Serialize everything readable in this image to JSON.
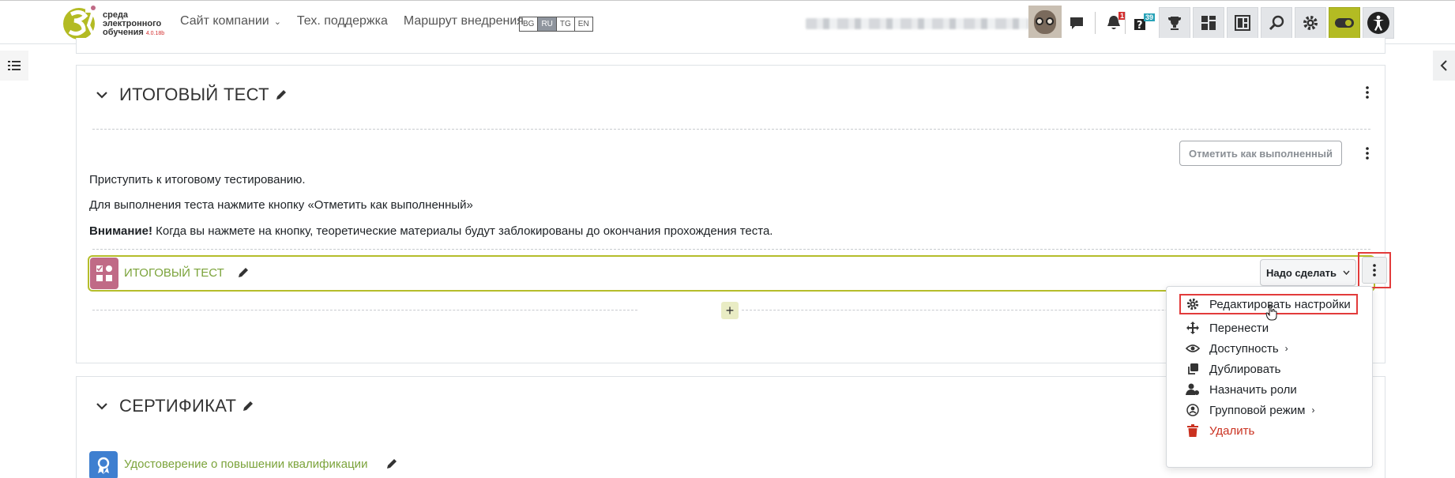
{
  "header": {
    "logo_lines": [
      "среда",
      "электронного",
      "обучения"
    ],
    "logo_version": "4.0.18b",
    "nav": [
      {
        "label": "Сайт компании",
        "has_caret": true
      },
      {
        "label": "Тех. поддержка"
      },
      {
        "label": "Маршрут внедрения"
      }
    ],
    "languages": [
      "BG",
      "RU",
      "TG",
      "EN"
    ],
    "active_language": "RU",
    "notification_count": "1",
    "questions_count": "39"
  },
  "section_test": {
    "title": "ИТОГОВЫЙ ТЕСТ",
    "mark_complete_button": "Отметить как выполненный",
    "paragraph_1": "Приступить к итоговому тестированию.",
    "paragraph_2": "Для выполнения теста нажмите кнопку «Отметить как выполненный»",
    "paragraph_3_bold": "Внимание!",
    "paragraph_3_rest": " Когда вы нажмете на кнопку, теоретические материалы будут заблокированы до окончания прохождения теста.",
    "activity_name": "ИТОГОВЫЙ ТЕСТ",
    "todo_button": "Надо сделать",
    "add_button": "+"
  },
  "section_cert": {
    "title": "СЕРТИФИКАТ",
    "activity_name": "Удостоверение о повышении квалификации"
  },
  "activity_menu": {
    "items": [
      {
        "label": "Редактировать настройки",
        "icon": "gear-icon"
      },
      {
        "label": "Перенести",
        "icon": "move-icon"
      },
      {
        "label": "Доступность",
        "icon": "eye-icon",
        "submenu": true
      },
      {
        "label": "Дублировать",
        "icon": "duplicate-icon"
      },
      {
        "label": "Назначить роли",
        "icon": "assign-roles-icon"
      },
      {
        "label": "Групповой режим",
        "icon": "group-mode-icon",
        "submenu": true
      },
      {
        "label": "Удалить",
        "icon": "trash-icon",
        "danger": true
      }
    ]
  },
  "colors": {
    "accent_olive": "#b3bb23",
    "activity_link": "#7ba33a",
    "highlight_red": "#e23b3b",
    "danger": "#ca3120",
    "quiz_icon_bg": "#c06a86",
    "cert_icon_bg": "#3e7fd0"
  }
}
